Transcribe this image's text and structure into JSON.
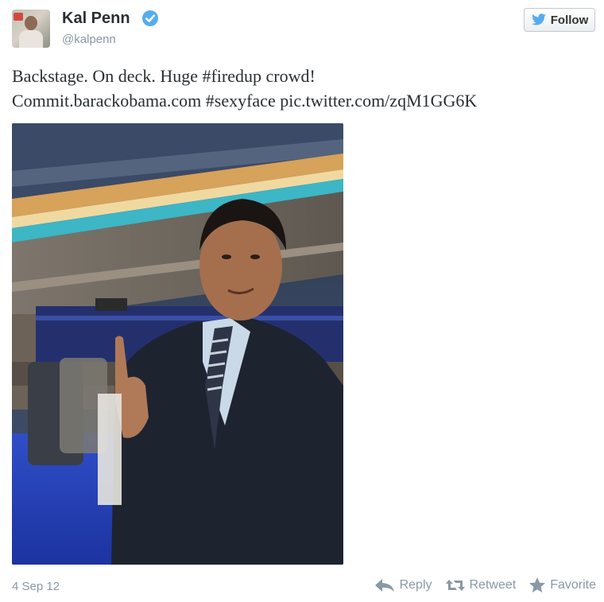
{
  "user": {
    "name": "Kal Penn",
    "handle": "@kalpenn",
    "verified": true,
    "avatar_icon": "profile-photo"
  },
  "follow_button": {
    "label": "Follow",
    "icon": "twitter-bird-icon"
  },
  "tweet": {
    "line1": {
      "before": "Backstage. On deck. Huge ",
      "hashtag": "#firedup",
      "after": " crowd!"
    },
    "line2": {
      "link": "Commit.barackobama.com",
      "sep1": " ",
      "hashtag": "#sexyface",
      "sep2": " ",
      "pic_link": "pic.twitter.com/zqM1GG6K"
    }
  },
  "media": {
    "description_icon": "embedded-photo"
  },
  "footer": {
    "date": "4 Sep 12",
    "actions": [
      {
        "label": "Reply",
        "icon": "reply-arrow-icon"
      },
      {
        "label": "Retweet",
        "icon": "retweet-icon"
      },
      {
        "label": "Favorite",
        "icon": "star-icon"
      }
    ]
  },
  "colors": {
    "twitter_blue": "#55acee",
    "muted_gray": "#8899a6",
    "text": "#292f33"
  }
}
